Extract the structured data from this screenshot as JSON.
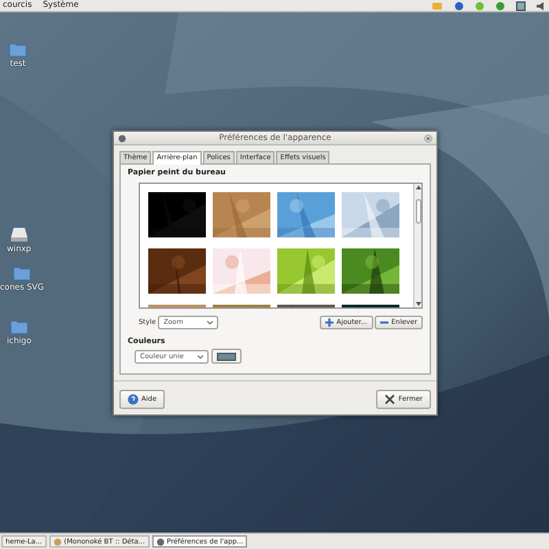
{
  "top_panel": {
    "menus": [
      "courcis",
      "Système"
    ]
  },
  "desktop_icons": [
    {
      "label": "test",
      "kind": "folder"
    },
    {
      "label": "winxp",
      "kind": "drive"
    },
    {
      "label": "cones SVG",
      "kind": "folder"
    },
    {
      "label": "ichigo",
      "kind": "folder"
    }
  ],
  "dialog": {
    "title": "Préférences de l'apparence",
    "tabs": [
      {
        "label": "Thème",
        "selected": false
      },
      {
        "label": "Arrière-plan",
        "selected": true
      },
      {
        "label": "Polices",
        "selected": false
      },
      {
        "label": "Interface",
        "selected": false
      },
      {
        "label": "Effets visuels",
        "selected": false
      }
    ],
    "section_title": "Papier peint du bureau",
    "style_label": "Style",
    "style_value": "Zoom",
    "add_button": "Ajouter...",
    "remove_button": "Enlever",
    "colors_title": "Couleurs",
    "color_mode": "Couleur unie",
    "help_button": "Aide",
    "close_button": "Fermer"
  },
  "taskbar": {
    "items": [
      {
        "label": "heme-La...",
        "selected": false
      },
      {
        "label": "(Mononoké BT :: Déta...",
        "selected": false
      },
      {
        "label": "Préférences de l'app...",
        "selected": true
      }
    ]
  }
}
